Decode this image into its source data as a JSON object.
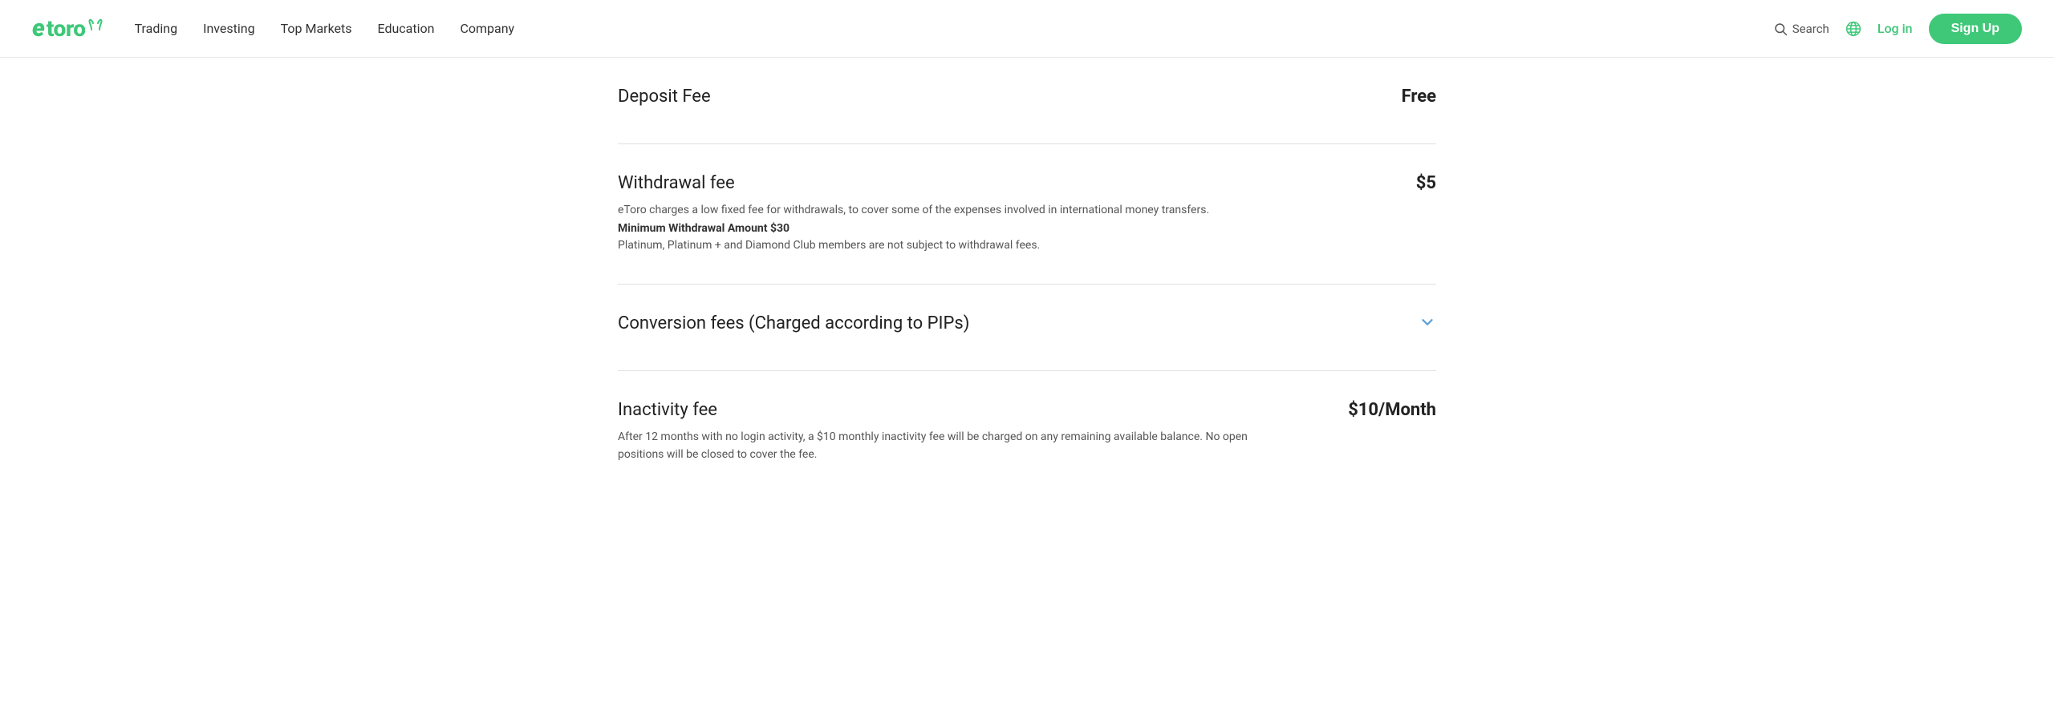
{
  "navbar": {
    "logo": "eToro",
    "nav_items": [
      {
        "label": "Trading",
        "id": "trading"
      },
      {
        "label": "Investing",
        "id": "investing"
      },
      {
        "label": "Top Markets",
        "id": "top-markets"
      },
      {
        "label": "Education",
        "id": "education"
      },
      {
        "label": "Company",
        "id": "company"
      }
    ],
    "search_label": "Search",
    "login_label": "Log in",
    "signup_label": "Sign Up"
  },
  "fees": [
    {
      "id": "deposit-fee",
      "title": "Deposit Fee",
      "description": null,
      "bold_note": null,
      "extra_note": null,
      "value": "Free",
      "has_chevron": false
    },
    {
      "id": "withdrawal-fee",
      "title": "Withdrawal fee",
      "description": "eToro charges a low fixed fee for withdrawals, to cover some of the expenses involved in international money transfers.",
      "bold_note": "Minimum Withdrawal Amount $30",
      "extra_note": "Platinum, Platinum + and Diamond Club members are not subject to withdrawal fees.",
      "value": "$5",
      "has_chevron": false
    },
    {
      "id": "conversion-fees",
      "title": "Conversion fees (Charged according to PIPs)",
      "description": null,
      "bold_note": null,
      "extra_note": null,
      "value": null,
      "has_chevron": true
    },
    {
      "id": "inactivity-fee",
      "title": "Inactivity fee",
      "description": "After 12 months with no login activity, a $10 monthly inactivity fee will be charged on any remaining available balance. No open positions will be closed to cover the fee.",
      "bold_note": null,
      "extra_note": null,
      "value": "$10/Month",
      "has_chevron": false
    }
  ]
}
